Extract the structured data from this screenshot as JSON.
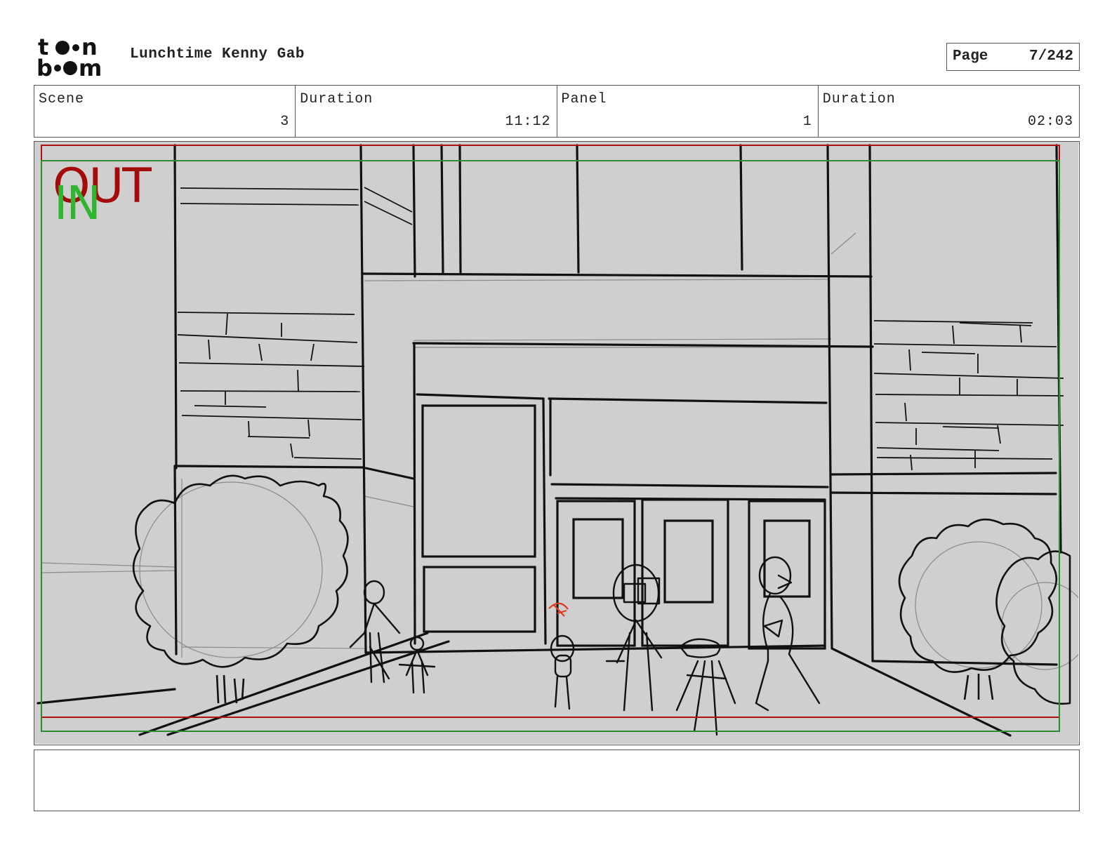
{
  "header": {
    "logo_text": "toon boom",
    "project_title": "Lunchtime Kenny Gab",
    "page_label": "Page",
    "page_value": "7/242"
  },
  "info": [
    {
      "label": "Scene",
      "value": "3"
    },
    {
      "label": "Duration",
      "value": "11:12"
    },
    {
      "label": "Panel",
      "value": "1"
    },
    {
      "label": "Duration",
      "value": "02:03"
    }
  ],
  "panel": {
    "safe_marker_out": "OUT",
    "safe_marker_in": "IN",
    "colors": {
      "background": "#cfcfcf",
      "out_frame": "#b01010",
      "in_frame": "#2e8b2e",
      "sketch": "#111111",
      "construction": "#8a8a8a",
      "accent": "#e03a1e"
    }
  },
  "notes": {
    "text": ""
  }
}
